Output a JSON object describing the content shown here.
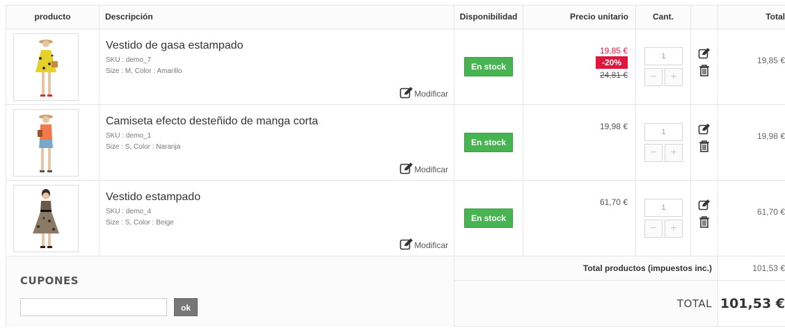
{
  "headers": {
    "product": "producto",
    "description": "Descripción",
    "availability": "Disponibilidad",
    "unit_price": "Precio unitario",
    "qty": "Cant.",
    "total": "Total"
  },
  "items": [
    {
      "name": "Vestido de gasa estampado",
      "sku": "SKU : demo_7",
      "attributes": "Size : M, Color : Amarillo",
      "modify_label": "Modificar",
      "stock": "En stock",
      "price": "19,85 €",
      "discount": "-20%",
      "old_price": "24,81 €",
      "qty": "1",
      "total": "19,85 €",
      "image_icon": "yellow-dress-model"
    },
    {
      "name": "Camiseta efecto desteñido de manga corta",
      "sku": "SKU : demo_1",
      "attributes": "Size : S, Color : Naranja",
      "modify_label": "Modificar",
      "stock": "En stock",
      "price": "19,98 €",
      "qty": "1",
      "total": "19,98 €",
      "image_icon": "orange-tshirt-model"
    },
    {
      "name": "Vestido estampado",
      "sku": "SKU : demo_4",
      "attributes": "Size : S, Color : Beige",
      "modify_label": "Modificar",
      "stock": "En stock",
      "price": "61,70 €",
      "qty": "1",
      "total": "61,70 €",
      "image_icon": "printed-dress-model"
    }
  ],
  "coupons": {
    "title": "CUPONES",
    "input_value": "",
    "button": "ok"
  },
  "totals": {
    "products_label": "Total productos (impuestos inc.)",
    "products_value": "101,53 €",
    "total_label": "TOTAL",
    "total_value": "101,53 €"
  },
  "colors": {
    "stock_green": "#46b450",
    "discount_red": "#e0173c",
    "coupon_button": "#777777"
  }
}
